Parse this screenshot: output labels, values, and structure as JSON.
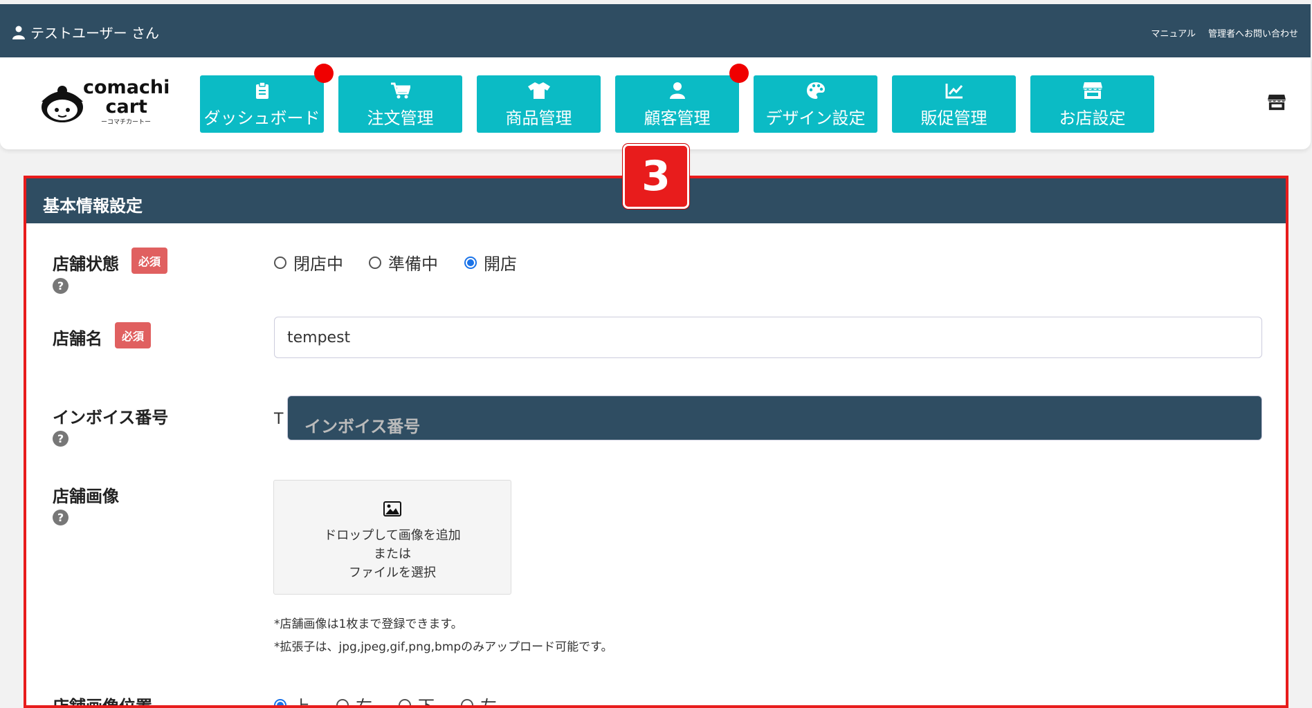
{
  "topbar": {
    "user_label": "テストユーザー さん",
    "manual_link": "マニュアル",
    "contact_link": "管理者へお問い合わせ"
  },
  "logo": {
    "line1": "comachi",
    "line2": "cart",
    "sub": "ーコマチカートー"
  },
  "nav": [
    {
      "label": "ダッシュボード",
      "icon": "clipboard-icon",
      "notification": true
    },
    {
      "label": "注文管理",
      "icon": "cart-icon",
      "notification": false
    },
    {
      "label": "商品管理",
      "icon": "tshirt-icon",
      "notification": false
    },
    {
      "label": "顧客管理",
      "icon": "user-icon",
      "notification": true
    },
    {
      "label": "デザイン設定",
      "icon": "palette-icon",
      "notification": false
    },
    {
      "label": "販促管理",
      "icon": "chart-line-icon",
      "notification": false
    },
    {
      "label": "お店設定",
      "icon": "store-icon",
      "notification": false
    }
  ],
  "step_badge": "3",
  "panel": {
    "title": "基本情報設定",
    "required_label": "必須",
    "help_glyph": "?",
    "store_status": {
      "label": "店舗状態",
      "options": [
        "閉店中",
        "準備中",
        "開店"
      ],
      "selected": "開店"
    },
    "store_name": {
      "label": "店舗名",
      "value": "tempest"
    },
    "invoice": {
      "label": "インボイス番号",
      "prefix": "T",
      "placeholder": "インボイス番号"
    },
    "store_image": {
      "label": "店舗画像",
      "drop_line1": "ドロップして画像を追加",
      "drop_line2": "または",
      "drop_line3": "ファイルを選択",
      "note1": "*店舗画像は1枚まで登録できます。",
      "note2": "*拡張子は、jpg,jpeg,gif,png,bmpのみアップロード可能です。"
    },
    "image_position": {
      "label": "店舗画像位置",
      "options": [
        "上",
        "右",
        "下",
        "左"
      ],
      "selected": "上"
    }
  },
  "colors": {
    "header": "#2f4d62",
    "nav_button": "#0bbbc5",
    "highlight": "#e81c1c",
    "required": "#e06060"
  }
}
